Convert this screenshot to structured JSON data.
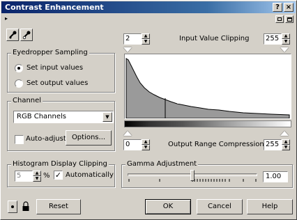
{
  "window": {
    "title": "Contrast Enhancement",
    "help_glyph": "?",
    "close_glyph": "×"
  },
  "input_clipping": {
    "low": "2",
    "label": "Input Value Clipping",
    "high": "255"
  },
  "output_range": {
    "low": "0",
    "label": "Output Range Compression",
    "high": "255"
  },
  "eyedropper": {
    "group_label": "Eyedropper Sampling",
    "options": [
      {
        "label": "Set input values",
        "selected": true
      },
      {
        "label": "Set output values",
        "selected": false
      }
    ]
  },
  "channel": {
    "group_label": "Channel",
    "selected": "RGB Channels",
    "auto_adjust_label": "Auto-adjust",
    "auto_adjust_checked": false,
    "options_button": "Options..."
  },
  "histogram_clipping": {
    "group_label": "Histogram Display Clipping",
    "value": "5",
    "unit": "%",
    "automatic_label": "Automatically",
    "automatic_checked": true
  },
  "gamma": {
    "group_label": "Gamma Adjustment",
    "value": "1.00"
  },
  "buttons": {
    "reset": "Reset",
    "ok": "OK",
    "cancel": "Cancel",
    "help": "Help"
  },
  "icons": [
    "eyedropper-black-icon",
    "eyedropper-white-icon",
    "preview-toggle-icon",
    "lock-icon"
  ]
}
